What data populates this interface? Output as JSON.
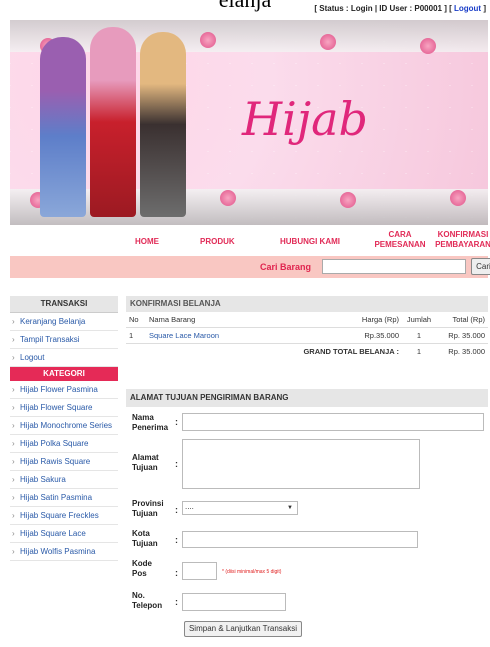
{
  "page": {
    "title_fragment": "elanja"
  },
  "status": {
    "prefix": "[ Status : Login | ID User : P00001 ] [",
    "logout": "Logout",
    "suffix": "]"
  },
  "banner": {
    "logo_text": "Hijab"
  },
  "nav": {
    "home": "HOME",
    "produk": "PRODUK",
    "hubungi": "HUBUNGI KAMI",
    "cara_line1": "CARA",
    "cara_line2": "PEMESANAN",
    "konf_line1": "KONFIRMASI",
    "konf_line2": "PEMBAYARAN"
  },
  "search": {
    "label": "Cari Barang",
    "button": "Cari",
    "value": ""
  },
  "sidebar": {
    "transaksi_head": "TRANSAKSI",
    "transaksi_items": [
      "Keranjang Belanja",
      "Tampil Transaksi",
      "Logout"
    ],
    "kategori_head": "KATEGORI",
    "kategori_items": [
      "Hijab Flower Pasmina",
      "Hijab Flower Square",
      "Hijab Monochrome Series",
      "Hijab Polka Square",
      "Hijab Rawis Square",
      "Hijab Sakura",
      "Hijab Satin Pasmina",
      "Hijab Square Freckles",
      "Hijab Square Lace",
      "Hijab Wolfis Pasmina"
    ]
  },
  "cart": {
    "head": "KONFIRMASI BELANJA",
    "columns": {
      "no": "No",
      "nama": "Nama Barang",
      "harga": "Harga (Rp)",
      "jumlah": "Jumlah",
      "total": "Total (Rp)"
    },
    "rows": [
      {
        "no": "1",
        "nama": "Square Lace Maroon",
        "harga": "Rp.35.000",
        "jumlah": "1",
        "total": "Rp. 35.000"
      }
    ],
    "grand_label": "GRAND TOTAL BELANJA :",
    "grand_qty": "1",
    "grand_total": "Rp. 35.000"
  },
  "shipping": {
    "head": "ALAMAT TUJUAN PENGIRIMAN BARANG",
    "nama_l1": "Nama",
    "nama_l2": "Penerima",
    "alamat_l1": "Alamat",
    "alamat_l2": "Tujuan",
    "prov_l1": "Provinsi",
    "prov_l2": "Tujuan",
    "prov_value": "....",
    "kota_l1": "Kota",
    "kota_l2": "Tujuan",
    "kode_l1": "Kode",
    "kode_l2": "Pos",
    "kode_hint": "* (diisi minimal/max 5 digit)",
    "telp_l1": "No.",
    "telp_l2": "Telepon",
    "colon": ":",
    "submit": "Simpan & Lanjutkan Transaksi"
  },
  "colors": {
    "accent": "#e12b57",
    "search_bar": "#f9c7c2",
    "link": "#2a5aa8"
  }
}
